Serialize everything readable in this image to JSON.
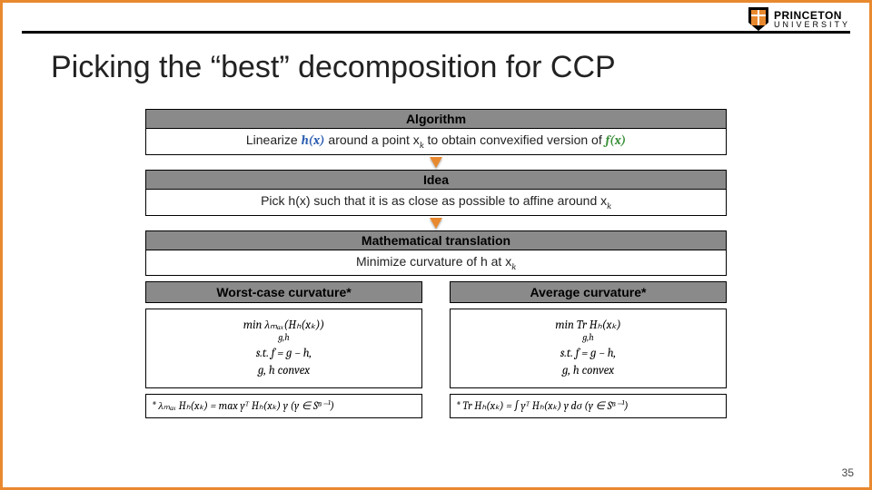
{
  "brand": {
    "top": "PRINCETON",
    "bottom": "UNIVERSITY"
  },
  "title": "Picking the “best” decomposition for CCP",
  "blocks": {
    "algo_head": "Algorithm",
    "algo_body_pre": "Linearize ",
    "algo_hx": "h(x)",
    "algo_body_mid": " around a point x",
    "algo_k": "k",
    "algo_body_post": " to obtain convexified version of ",
    "algo_fx": "f(x)",
    "idea_head": "Idea",
    "idea_pre": "Pick h(x) such that it is as close as possible to affine around x",
    "math_head": "Mathematical translation",
    "math_body": "Minimize curvature of h at x"
  },
  "cols": {
    "worst_head": "Worst-case curvature*",
    "avg_head": "Average curvature*",
    "worst_min": "min  λₘₐₓ(Hₕ(xₖ))",
    "avg_min": "min  Tr Hₕ(xₖ)",
    "sub_gh": "g,h",
    "st": "s.t.  f = g − h,",
    "convex": "g, h  convex",
    "worst_foot": "* λₘₐₓ Hₕ(xₖ) = max  yᵀ Hₕ(xₖ) y   (y ∈ Sⁿ⁻¹)",
    "avg_foot": "* Tr Hₕ(xₖ) = ∫  yᵀ Hₕ(xₖ) y  dσ   (y ∈ Sⁿ⁻¹)"
  },
  "page": "35"
}
